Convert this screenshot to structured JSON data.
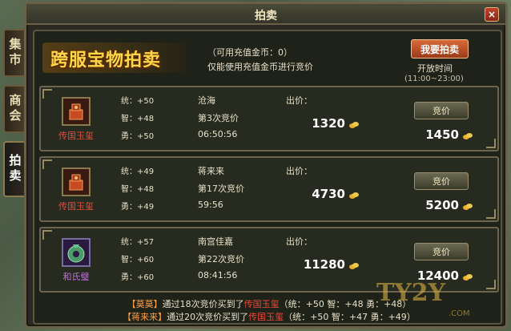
{
  "window": {
    "title": "拍卖",
    "close_label": "×"
  },
  "side_tabs": [
    {
      "label": "集市",
      "active": false
    },
    {
      "label": "商会",
      "active": false
    },
    {
      "label": "拍卖",
      "active": true
    }
  ],
  "header": {
    "banner": "跨服宝物拍卖",
    "coin_info": "（可用充值金币：0）",
    "coin_note": "仅能使用充值金币进行竞价",
    "bid_me_button": "我要拍卖",
    "open_time_label": "开放时间",
    "open_time_value": "(11:00~23:00)"
  },
  "price_label": "出价：",
  "bid_button": "竞价",
  "auctions": [
    {
      "item_name": "传国玉玺",
      "item_icon": "jade-seal-icon",
      "rarity": "red",
      "tong": "统：+50",
      "zhi": "智：+48",
      "yong": "勇：+50",
      "bidder": "沧海",
      "round": "第3次竞价",
      "timer": "06:50:56",
      "current_price": "1320",
      "next_price": "1450"
    },
    {
      "item_name": "传国玉玺",
      "item_icon": "jade-seal-icon",
      "rarity": "red",
      "tong": "统：+49",
      "zhi": "智：+48",
      "yong": "勇：+49",
      "bidder": "蒋来来",
      "round": "第17次竞价",
      "timer": "59:56",
      "current_price": "4730",
      "next_price": "5200"
    },
    {
      "item_name": "和氏璧",
      "item_icon": "jade-disc-icon",
      "rarity": "purple",
      "tong": "统：+57",
      "zhi": "智：+60",
      "yong": "勇：+60",
      "bidder": "南宫佳嘉",
      "round": "第22次竞价",
      "timer": "08:41:56",
      "current_price": "11280",
      "next_price": "12400"
    }
  ],
  "logs": [
    {
      "name": "【莫莫】",
      "text1": "通过18次竞价买到了",
      "item": "传国玉玺",
      "text2": "（统：+50 智：+48 勇：+48）"
    },
    {
      "name": "【蒋来来】",
      "text1": "通过20次竞价买到了",
      "item": "传国玉玺",
      "text2": "（统：+50 智：+47 勇：+49）"
    }
  ],
  "watermark": {
    "logo": "TY2Y",
    "sub": ".COM"
  },
  "colors": {
    "gold": "#ffd84a",
    "red_item": "#e84a3a",
    "purple_item": "#c070e0",
    "log_name": "#ffa040"
  }
}
